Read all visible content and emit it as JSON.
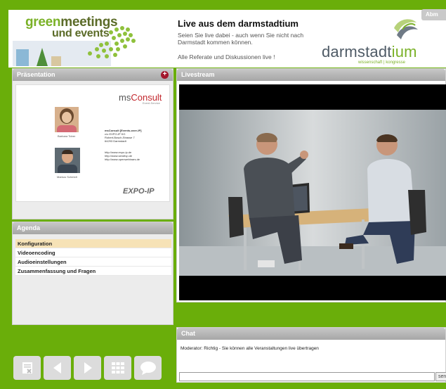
{
  "header": {
    "logo_line1_a": "green",
    "logo_line1_b": "meetings",
    "logo_line2": "und events",
    "title": "Live aus dem darmstadtium",
    "description": "Seien Sie live dabei - auch wenn Sie nicht nach Darmstadt kommen können.",
    "description2": "Alle Referate und Diskussionen live !",
    "venue_logo_a": "darmstadt",
    "venue_logo_b": "ium",
    "venue_sub": "wissenschaft | kongresse",
    "logout_label": "Abm"
  },
  "presentation": {
    "title": "Präsentation",
    "add_icon": "plus-icon",
    "slide": {
      "brand_a": "ms",
      "brand_b": "Consult",
      "brand_tag": "Event-Service",
      "company": "msConsult [Events-over-IP]",
      "company_line2": "c/o EXPO-IP KG",
      "company_line3": "Robert-Bosch-Strasse 7",
      "company_line4": "64293 Darmstadt",
      "links": [
        "http://www.expo-ip.de",
        "http://www.sendtvp.de",
        "http://www.openwebinars.de"
      ],
      "person1": "Barbara Tober",
      "person2": "Markus Schmidt",
      "footer_brand": "EXPO-IP"
    }
  },
  "agenda": {
    "title": "Agenda",
    "items": [
      {
        "label": "Konfiguration",
        "active": true
      },
      {
        "label": "Videoencoding",
        "active": false
      },
      {
        "label": "Audioeinstellungen",
        "active": false
      },
      {
        "label": "Zusammenfassung und Fragen",
        "active": false
      }
    ]
  },
  "livestream": {
    "title": "Livestream"
  },
  "chat": {
    "title": "Chat",
    "message": "Moderator: Richtig - Sie können alle Veranstaltungen live übertragen",
    "input_placeholder": "",
    "send_label": "sen"
  },
  "toolbar": {
    "buttons": [
      "document-close-icon",
      "previous-icon",
      "next-icon",
      "grid-icon",
      "speech-bubble-icon"
    ]
  },
  "colors": {
    "background": "#6aae0a",
    "panel_header": "#b3b3b3",
    "active_agenda": "#f6e2b6",
    "accent_green": "#7ab127"
  }
}
